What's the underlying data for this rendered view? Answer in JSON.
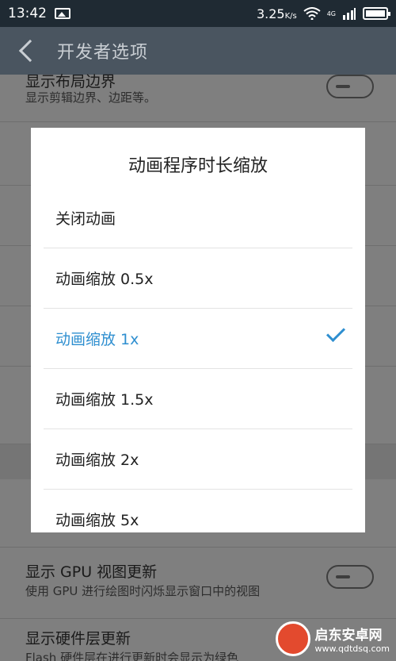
{
  "status_bar": {
    "time": "13:42",
    "speed_value": "3.25",
    "speed_unit": "K/s",
    "network": "4G",
    "icons": [
      "image-icon",
      "wifi-icon",
      "signal-icon",
      "battery-icon"
    ]
  },
  "action_bar": {
    "title": "开发者选项",
    "back_icon": "back-arrow-icon"
  },
  "background_list": {
    "item0": {
      "title": "显示布局边界",
      "subtitle": "显示剪辑边界、边距等。"
    },
    "item_gpu": {
      "title": "显示 GPU 视图更新",
      "subtitle": "使用 GPU 进行绘图时闪烁显示窗口中的视图"
    },
    "item_hw": {
      "title": "显示硬件层更新",
      "subtitle": "Flash 硬件层在进行更新时会显示为绿色"
    }
  },
  "dialog": {
    "title": "动画程序时长缩放",
    "options": [
      {
        "label": "关闭动画",
        "selected": false
      },
      {
        "label": "动画缩放 0.5x",
        "selected": false
      },
      {
        "label": "动画缩放 1x",
        "selected": true
      },
      {
        "label": "动画缩放 1.5x",
        "selected": false
      },
      {
        "label": "动画缩放 2x",
        "selected": false
      },
      {
        "label": "动画缩放 5x",
        "selected": false
      }
    ],
    "accent_color": "#2f8fd0"
  },
  "watermark": {
    "line1": "启东安卓网",
    "line2": "www.qdtdsq.com"
  }
}
